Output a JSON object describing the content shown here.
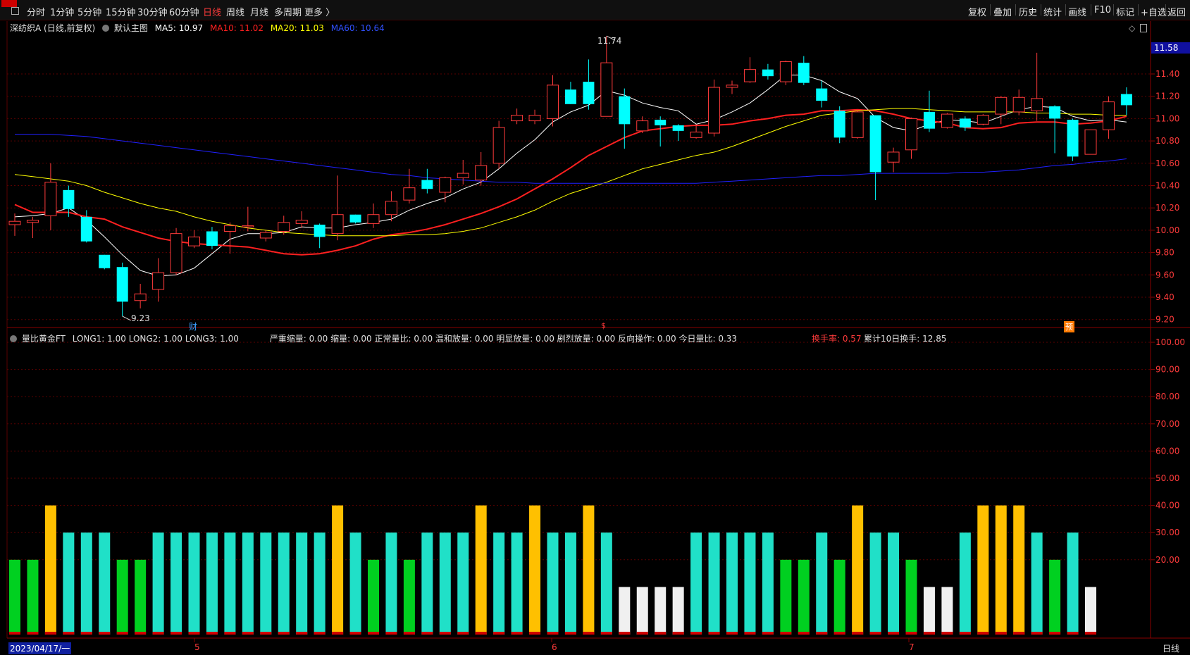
{
  "toolbar": {
    "periods": [
      "分时",
      "1分钟",
      "5分钟",
      "15分钟",
      "30分钟",
      "60分钟",
      "日线",
      "周线",
      "月线",
      "多周期",
      "更多 〉"
    ],
    "active_period": "日线",
    "tools": [
      "复权",
      "叠加",
      "历史",
      "统计",
      "画线",
      "F10",
      "标记",
      "+自选",
      "返回"
    ]
  },
  "main_legend": {
    "stock": "深纺织A (日线,前复权)",
    "template": "默认主图",
    "ma5": "MA5: 10.97",
    "ma10": "MA10: 11.02",
    "ma20": "MA20: 11.03",
    "ma60": "MA60: 10.64"
  },
  "sub_legend": {
    "name": "量比黄金FT",
    "params": "LONG1: 1.00  LONG2: 1.00  LONG3: 1.00",
    "values": "严重缩量: 0.00  缩量: 0.00  正常量比: 0.00  温和放量: 0.00  明显放量: 0.00  剧烈放量: 0.00  反向操作: 0.00  今日量比: 0.33",
    "turnover_label": "换手率: 0.57",
    "turnover_10d": "累计10日换手: 12.85"
  },
  "price_axis": [
    "11.40",
    "11.20",
    "11.00",
    "10.80",
    "10.60",
    "10.40",
    "10.20",
    "10.00",
    "9.80",
    "9.60",
    "9.40",
    "9.20"
  ],
  "current_price": "11.58",
  "high_label": "11.74",
  "low_label": "9.23",
  "markers": {
    "cai": "财",
    "s": "$",
    "yu": "预"
  },
  "sub_axis": [
    "100.00",
    "90.00",
    "80.00",
    "70.00",
    "60.00",
    "50.00",
    "40.00",
    "30.00",
    "20.00"
  ],
  "x_axis": {
    "start_date": "2023/04/17/一",
    "months": [
      "5",
      "6",
      "7"
    ],
    "period_label": "日线"
  },
  "colors": {
    "up": "#ff3b3b",
    "down": "#00ffff",
    "ma5": "#ffffff",
    "ma10": "#ff2020",
    "ma20": "#ffff00",
    "ma60": "#2020ff",
    "grid": "#5a0000"
  },
  "chart_data": [
    {
      "type": "candlestick",
      "title": "深纺织A (日线,前复权)",
      "ylim": [
        9.15,
        11.74
      ],
      "candles": [
        {
          "o": 10.05,
          "h": 10.15,
          "l": 9.95,
          "c": 10.08
        },
        {
          "o": 10.07,
          "h": 10.12,
          "l": 9.93,
          "c": 10.09
        },
        {
          "o": 10.13,
          "h": 10.6,
          "l": 10.0,
          "c": 10.43
        },
        {
          "o": 10.36,
          "h": 10.4,
          "l": 10.12,
          "c": 10.19
        },
        {
          "o": 10.12,
          "h": 10.18,
          "l": 9.89,
          "c": 9.9
        },
        {
          "o": 9.78,
          "h": 9.78,
          "l": 9.65,
          "c": 9.66
        },
        {
          "o": 9.67,
          "h": 9.71,
          "l": 9.23,
          "c": 9.36
        },
        {
          "o": 9.37,
          "h": 9.52,
          "l": 9.3,
          "c": 9.43
        },
        {
          "o": 9.47,
          "h": 9.75,
          "l": 9.36,
          "c": 9.62
        },
        {
          "o": 9.62,
          "h": 10.02,
          "l": 9.6,
          "c": 9.97
        },
        {
          "o": 9.86,
          "h": 10.0,
          "l": 9.84,
          "c": 9.94
        },
        {
          "o": 9.99,
          "h": 10.03,
          "l": 9.83,
          "c": 9.86
        },
        {
          "o": 9.99,
          "h": 10.07,
          "l": 9.79,
          "c": 10.04
        },
        {
          "o": 10.03,
          "h": 10.21,
          "l": 9.99,
          "c": 10.04
        },
        {
          "o": 9.93,
          "h": 10.0,
          "l": 9.9,
          "c": 9.98
        },
        {
          "o": 9.99,
          "h": 10.13,
          "l": 9.96,
          "c": 10.07
        },
        {
          "o": 10.06,
          "h": 10.17,
          "l": 10.02,
          "c": 10.09
        },
        {
          "o": 10.05,
          "h": 10.06,
          "l": 9.84,
          "c": 9.94
        },
        {
          "o": 9.97,
          "h": 10.49,
          "l": 9.91,
          "c": 10.14
        },
        {
          "o": 10.14,
          "h": 10.14,
          "l": 10.06,
          "c": 10.07
        },
        {
          "o": 10.06,
          "h": 10.24,
          "l": 10.02,
          "c": 10.14
        },
        {
          "o": 10.14,
          "h": 10.35,
          "l": 10.08,
          "c": 10.26
        },
        {
          "o": 10.27,
          "h": 10.55,
          "l": 10.24,
          "c": 10.38
        },
        {
          "o": 10.45,
          "h": 10.55,
          "l": 10.33,
          "c": 10.37
        },
        {
          "o": 10.34,
          "h": 10.48,
          "l": 10.25,
          "c": 10.47
        },
        {
          "o": 10.47,
          "h": 10.63,
          "l": 10.41,
          "c": 10.51
        },
        {
          "o": 10.45,
          "h": 10.7,
          "l": 10.4,
          "c": 10.58
        },
        {
          "o": 10.6,
          "h": 10.98,
          "l": 10.55,
          "c": 10.92
        },
        {
          "o": 10.98,
          "h": 11.09,
          "l": 10.95,
          "c": 11.03
        },
        {
          "o": 10.98,
          "h": 11.08,
          "l": 10.95,
          "c": 11.03
        },
        {
          "o": 11.0,
          "h": 11.39,
          "l": 10.93,
          "c": 11.3
        },
        {
          "o": 11.26,
          "h": 11.33,
          "l": 11.13,
          "c": 11.13
        },
        {
          "o": 11.33,
          "h": 11.53,
          "l": 11.08,
          "c": 11.13
        },
        {
          "o": 11.02,
          "h": 11.74,
          "l": 11.02,
          "c": 11.5
        },
        {
          "o": 11.2,
          "h": 11.27,
          "l": 10.73,
          "c": 10.95
        },
        {
          "o": 10.89,
          "h": 11.02,
          "l": 10.87,
          "c": 10.98
        },
        {
          "o": 10.99,
          "h": 11.02,
          "l": 10.75,
          "c": 10.94
        },
        {
          "o": 10.94,
          "h": 10.95,
          "l": 10.8,
          "c": 10.89
        },
        {
          "o": 10.83,
          "h": 10.94,
          "l": 10.82,
          "c": 10.88
        },
        {
          "o": 10.87,
          "h": 11.35,
          "l": 10.84,
          "c": 11.28
        },
        {
          "o": 11.28,
          "h": 11.34,
          "l": 11.22,
          "c": 11.3
        },
        {
          "o": 11.33,
          "h": 11.55,
          "l": 11.32,
          "c": 11.44
        },
        {
          "o": 11.44,
          "h": 11.49,
          "l": 11.35,
          "c": 11.38
        },
        {
          "o": 11.33,
          "h": 11.52,
          "l": 11.3,
          "c": 11.51
        },
        {
          "o": 11.5,
          "h": 11.56,
          "l": 11.3,
          "c": 11.32
        },
        {
          "o": 11.27,
          "h": 11.34,
          "l": 11.1,
          "c": 11.16
        },
        {
          "o": 11.07,
          "h": 11.11,
          "l": 10.78,
          "c": 10.83
        },
        {
          "o": 10.83,
          "h": 11.07,
          "l": 10.82,
          "c": 11.06
        },
        {
          "o": 11.03,
          "h": 11.03,
          "l": 10.27,
          "c": 10.52
        },
        {
          "o": 10.61,
          "h": 10.74,
          "l": 10.52,
          "c": 10.7
        },
        {
          "o": 10.72,
          "h": 11.01,
          "l": 10.64,
          "c": 11.0
        },
        {
          "o": 11.06,
          "h": 11.25,
          "l": 10.88,
          "c": 10.91
        },
        {
          "o": 10.92,
          "h": 11.05,
          "l": 10.91,
          "c": 11.04
        },
        {
          "o": 11.0,
          "h": 11.02,
          "l": 10.89,
          "c": 10.92
        },
        {
          "o": 10.95,
          "h": 11.04,
          "l": 10.94,
          "c": 11.03
        },
        {
          "o": 11.04,
          "h": 11.2,
          "l": 10.95,
          "c": 11.19
        },
        {
          "o": 11.06,
          "h": 11.26,
          "l": 11.03,
          "c": 11.19
        },
        {
          "o": 11.07,
          "h": 11.59,
          "l": 10.98,
          "c": 11.18
        },
        {
          "o": 11.11,
          "h": 11.12,
          "l": 10.69,
          "c": 11.0
        },
        {
          "o": 10.99,
          "h": 11.0,
          "l": 10.62,
          "c": 10.66
        },
        {
          "o": 10.68,
          "h": 10.9,
          "l": 10.68,
          "c": 10.9
        },
        {
          "o": 10.9,
          "h": 11.2,
          "l": 10.82,
          "c": 11.15
        },
        {
          "o": 11.22,
          "h": 11.28,
          "l": 11.03,
          "c": 11.12
        }
      ],
      "ma": [
        {
          "name": "MA5",
          "values": [
            10.12,
            10.13,
            10.15,
            10.2,
            10.09,
            9.94,
            9.78,
            9.64,
            9.59,
            9.6,
            9.66,
            9.79,
            9.92,
            9.97,
            9.97,
            9.98,
            10.03,
            10.02,
            10.02,
            10.05,
            10.07,
            10.1,
            10.18,
            10.24,
            10.29,
            10.37,
            10.43,
            10.55,
            10.69,
            10.81,
            10.97,
            11.06,
            11.12,
            11.25,
            11.21,
            11.14,
            11.1,
            11.07,
            10.95,
            10.99,
            11.06,
            11.14,
            11.26,
            11.39,
            11.39,
            11.34,
            11.24,
            11.18,
            11.01,
            10.92,
            10.89,
            10.95,
            10.99,
            10.98,
            10.96,
            11.02,
            11.08,
            11.11,
            11.1,
            11.02,
            10.98,
            10.99,
            10.97
          ]
        },
        {
          "name": "MA10",
          "values": [
            10.23,
            10.16,
            10.16,
            10.16,
            10.12,
            10.1,
            10.03,
            9.98,
            9.93,
            9.9,
            9.88,
            9.87,
            9.86,
            9.85,
            9.82,
            9.79,
            9.78,
            9.79,
            9.82,
            9.86,
            9.92,
            9.96,
            9.98,
            10.01,
            10.05,
            10.1,
            10.15,
            10.21,
            10.28,
            10.37,
            10.46,
            10.56,
            10.67,
            10.75,
            10.83,
            10.89,
            10.91,
            10.93,
            10.94,
            10.94,
            10.95,
            10.98,
            11.0,
            11.03,
            11.04,
            11.07,
            11.07,
            11.08,
            11.07,
            11.04,
            11.0,
            10.98,
            10.96,
            10.92,
            10.91,
            10.92,
            10.96,
            10.97,
            10.97,
            10.95,
            10.96,
            10.98,
            11.02
          ]
        },
        {
          "name": "MA20",
          "values": [
            10.5,
            10.48,
            10.46,
            10.44,
            10.4,
            10.34,
            10.29,
            10.24,
            10.2,
            10.17,
            10.12,
            10.08,
            10.05,
            10.02,
            10.0,
            9.98,
            9.97,
            9.96,
            9.95,
            9.95,
            9.95,
            9.95,
            9.96,
            9.96,
            9.97,
            9.99,
            10.02,
            10.07,
            10.12,
            10.18,
            10.26,
            10.33,
            10.38,
            10.43,
            10.49,
            10.55,
            10.59,
            10.63,
            10.67,
            10.7,
            10.75,
            10.81,
            10.87,
            10.93,
            10.98,
            11.03,
            11.05,
            11.07,
            11.08,
            11.09,
            11.09,
            11.08,
            11.07,
            11.06,
            11.06,
            11.06,
            11.06,
            11.05,
            11.05,
            11.04,
            11.04,
            11.03,
            11.03
          ]
        },
        {
          "name": "MA60",
          "values": [
            10.86,
            10.86,
            10.86,
            10.85,
            10.84,
            10.82,
            10.8,
            10.78,
            10.76,
            10.74,
            10.72,
            10.7,
            10.68,
            10.66,
            10.64,
            10.62,
            10.6,
            10.58,
            10.56,
            10.54,
            10.52,
            10.5,
            10.49,
            10.47,
            10.46,
            10.45,
            10.44,
            10.43,
            10.43,
            10.42,
            10.42,
            10.42,
            10.42,
            10.42,
            10.42,
            10.42,
            10.42,
            10.42,
            10.42,
            10.43,
            10.44,
            10.45,
            10.46,
            10.47,
            10.48,
            10.49,
            10.49,
            10.5,
            10.51,
            10.51,
            10.51,
            10.51,
            10.51,
            10.52,
            10.52,
            10.53,
            10.54,
            10.56,
            10.58,
            10.59,
            10.61,
            10.62,
            10.64
          ]
        }
      ]
    },
    {
      "type": "bar",
      "title": "量比黄金FT",
      "ylim": [
        0,
        100
      ],
      "values": [
        20,
        20,
        40,
        30,
        30,
        30,
        20,
        20,
        30,
        30,
        30,
        30,
        30,
        30,
        30,
        30,
        30,
        30,
        40,
        30,
        20,
        30,
        20,
        30,
        30,
        30,
        40,
        30,
        30,
        40,
        30,
        30,
        40,
        30,
        10,
        10,
        10,
        10,
        30,
        30,
        30,
        30,
        30,
        20,
        20,
        30,
        20,
        40,
        30,
        30,
        20,
        10,
        10,
        30,
        40,
        40,
        40,
        30,
        20,
        30,
        10
      ],
      "colors": [
        "green",
        "green",
        "gold",
        "cyan",
        "cyan",
        "cyan",
        "green",
        "green",
        "cyan",
        "cyan",
        "cyan",
        "cyan",
        "cyan",
        "cyan",
        "cyan",
        "cyan",
        "cyan",
        "cyan",
        "gold",
        "cyan",
        "green",
        "cyan",
        "green",
        "cyan",
        "cyan",
        "cyan",
        "gold",
        "cyan",
        "cyan",
        "gold",
        "cyan",
        "cyan",
        "gold",
        "cyan",
        "white",
        "white",
        "white",
        "white",
        "cyan",
        "cyan",
        "cyan",
        "cyan",
        "cyan",
        "green",
        "green",
        "cyan",
        "green",
        "gold",
        "cyan",
        "cyan",
        "green",
        "white",
        "white",
        "cyan",
        "gold",
        "gold",
        "gold",
        "cyan",
        "green",
        "cyan",
        "white"
      ]
    }
  ]
}
